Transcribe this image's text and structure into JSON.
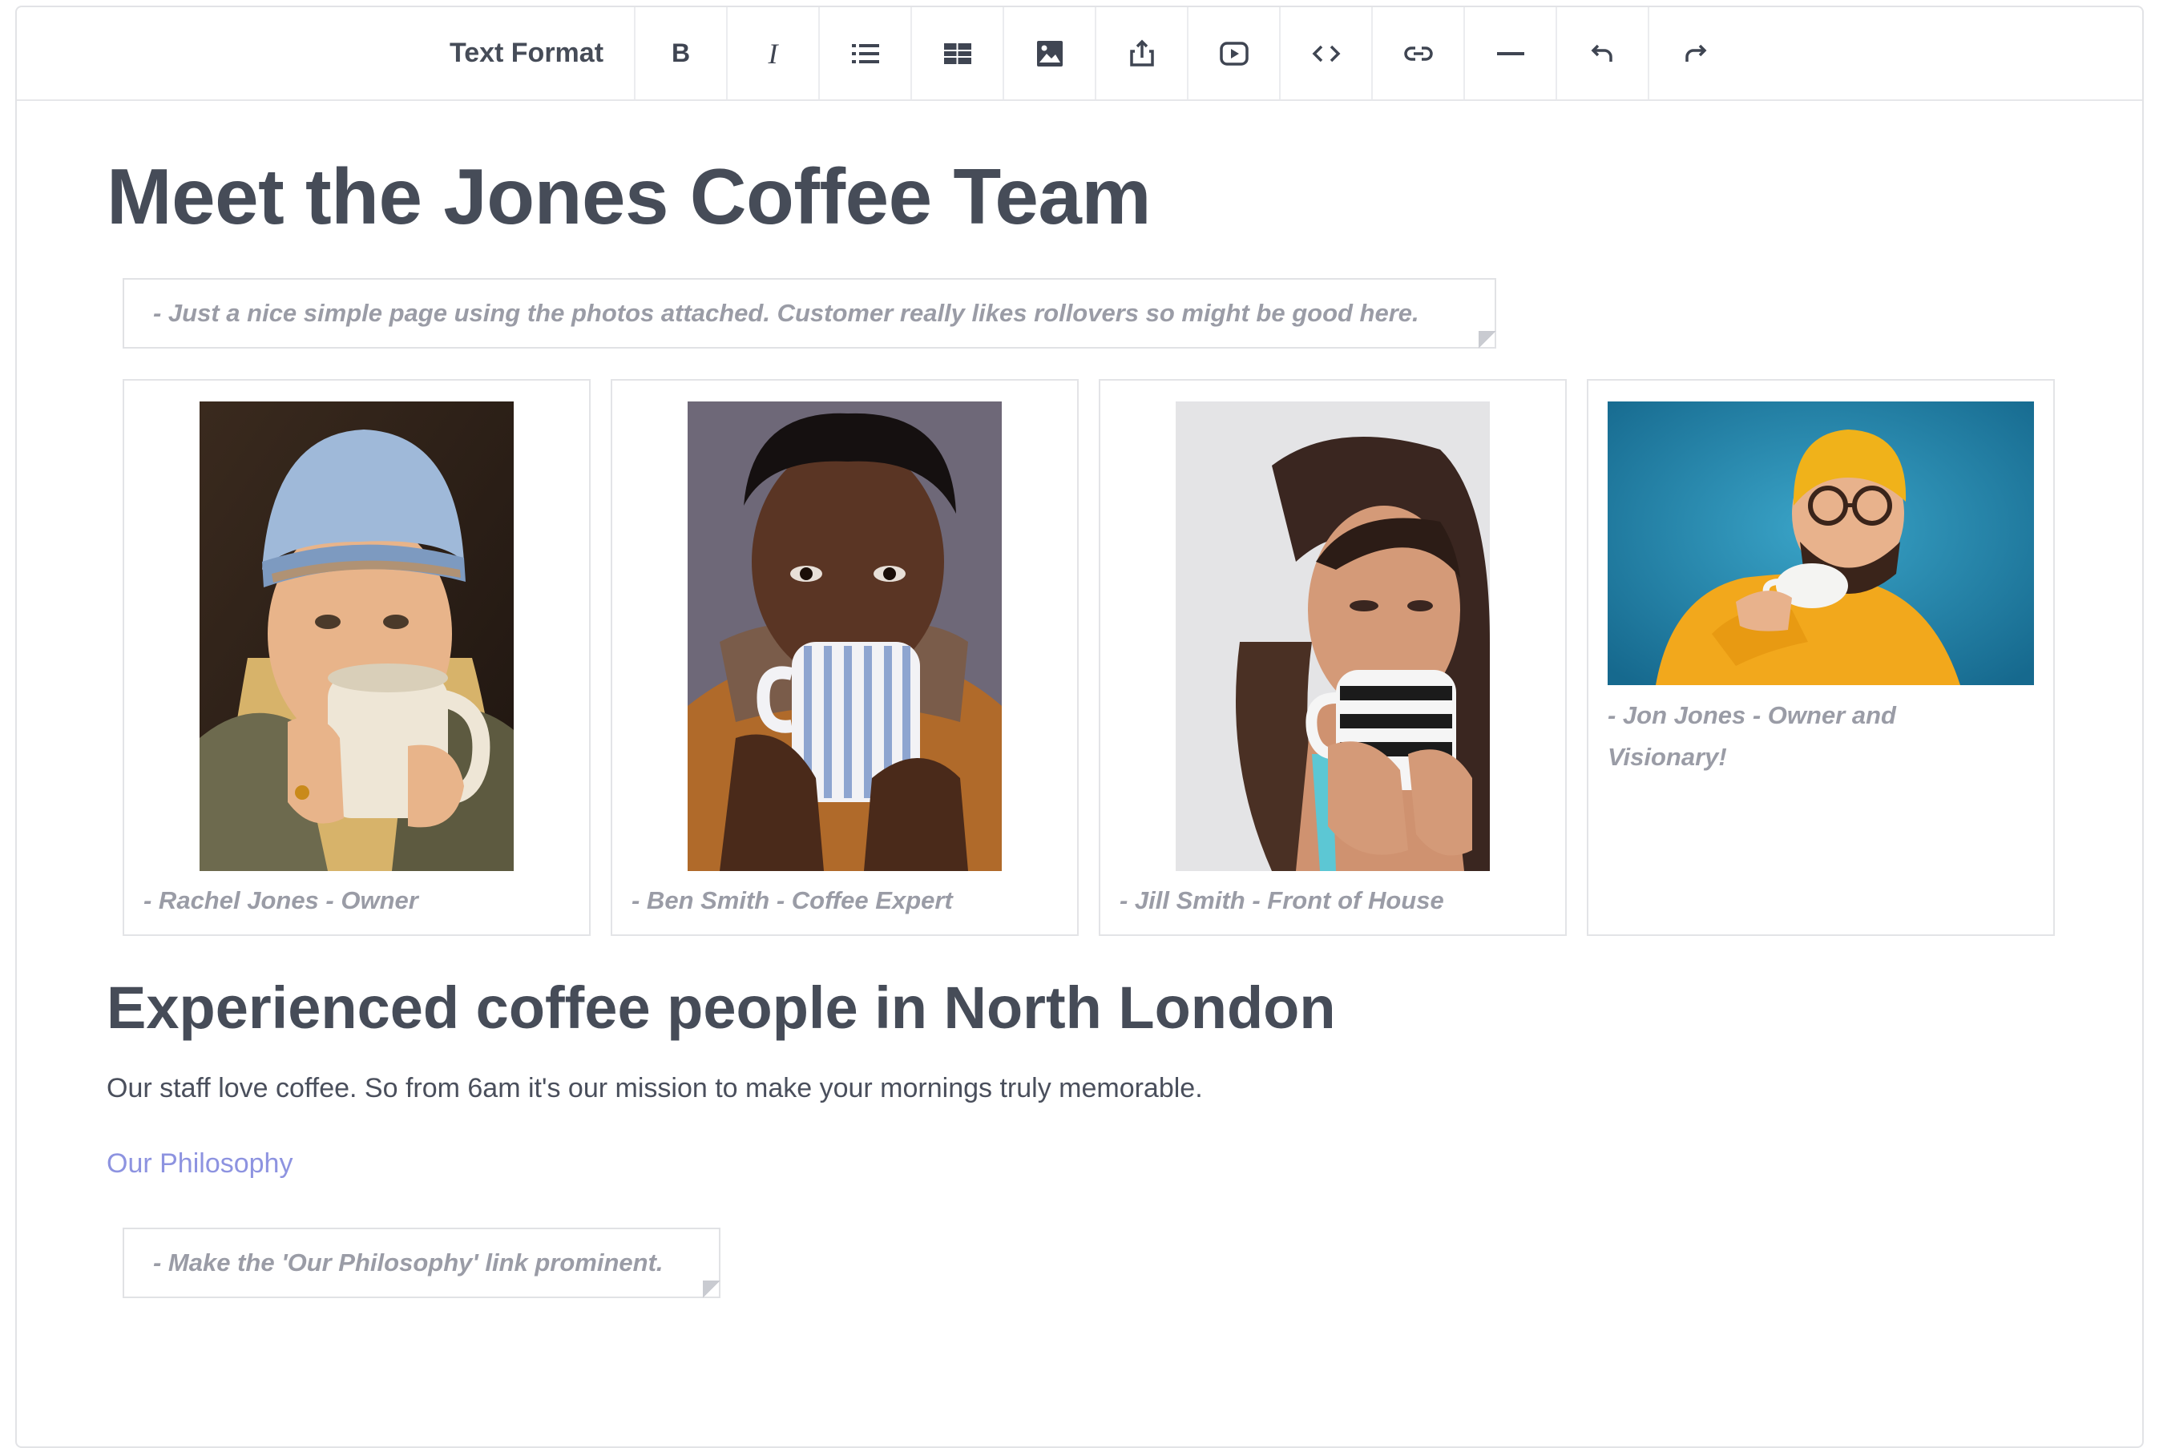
{
  "toolbar": {
    "format_label": "Text Format",
    "bold_label": "B",
    "italic_label": "I",
    "buttons": [
      {
        "icon": "bold-icon"
      },
      {
        "icon": "italic-icon"
      },
      {
        "icon": "bullet-list-icon"
      },
      {
        "icon": "table-icon"
      },
      {
        "icon": "image-icon"
      },
      {
        "icon": "upload-icon"
      },
      {
        "icon": "video-icon"
      },
      {
        "icon": "code-icon"
      },
      {
        "icon": "link-icon"
      },
      {
        "icon": "horizontal-rule-icon"
      },
      {
        "icon": "undo-icon"
      },
      {
        "icon": "redo-icon"
      }
    ]
  },
  "page": {
    "title": "Meet the Jones Coffee Team",
    "note1": "- Just a nice simple page using the photos attached. Customer really likes rollovers so might be good here.",
    "team": [
      {
        "caption": "- Rachel Jones - Owner"
      },
      {
        "caption": "- Ben Smith - Coffee Expert"
      },
      {
        "caption": "- Jill Smith - Front of House"
      },
      {
        "caption": "- Jon Jones - Owner and Visionary!"
      }
    ],
    "subtitle": "Experienced coffee people in North London",
    "paragraph": "Our staff love coffee. So from 6am it's our mission to make your mornings truly memorable.",
    "link": "Our Philosophy",
    "note2": "- Make the 'Our Philosophy' link prominent."
  },
  "colors": {
    "heading": "#464c58",
    "note_text": "#9a9ca6",
    "link": "#8d93e0",
    "border": "#e2e3e6"
  }
}
